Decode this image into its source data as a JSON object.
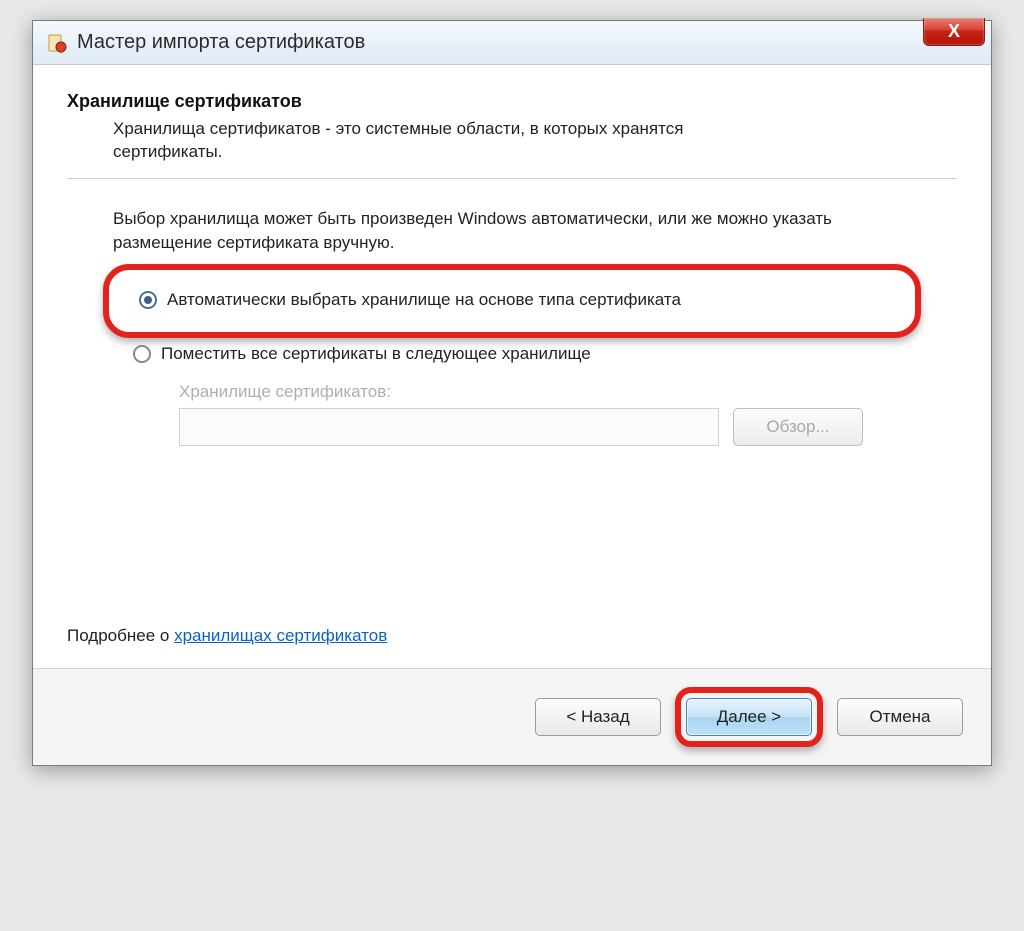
{
  "window": {
    "title": "Мастер импорта сертификатов",
    "close_label": "X"
  },
  "section": {
    "heading": "Хранилище сертификатов",
    "description": "Хранилища сертификатов - это системные области, в которых хранятся сертификаты."
  },
  "choice": {
    "intro": "Выбор хранилища может быть произведен Windows автоматически, или же можно указать размещение сертификата вручную.",
    "option_auto": "Автоматически выбрать хранилище на основе типа сертификата",
    "option_manual": "Поместить все сертификаты в следующее хранилище",
    "selected": "auto"
  },
  "store": {
    "label": "Хранилище сертификатов:",
    "value": "",
    "browse": "Обзор..."
  },
  "more": {
    "prefix": "Подробнее о ",
    "link": "хранилищах сертификатов"
  },
  "buttons": {
    "back": "< Назад",
    "next": "Далее >",
    "cancel": "Отмена"
  }
}
